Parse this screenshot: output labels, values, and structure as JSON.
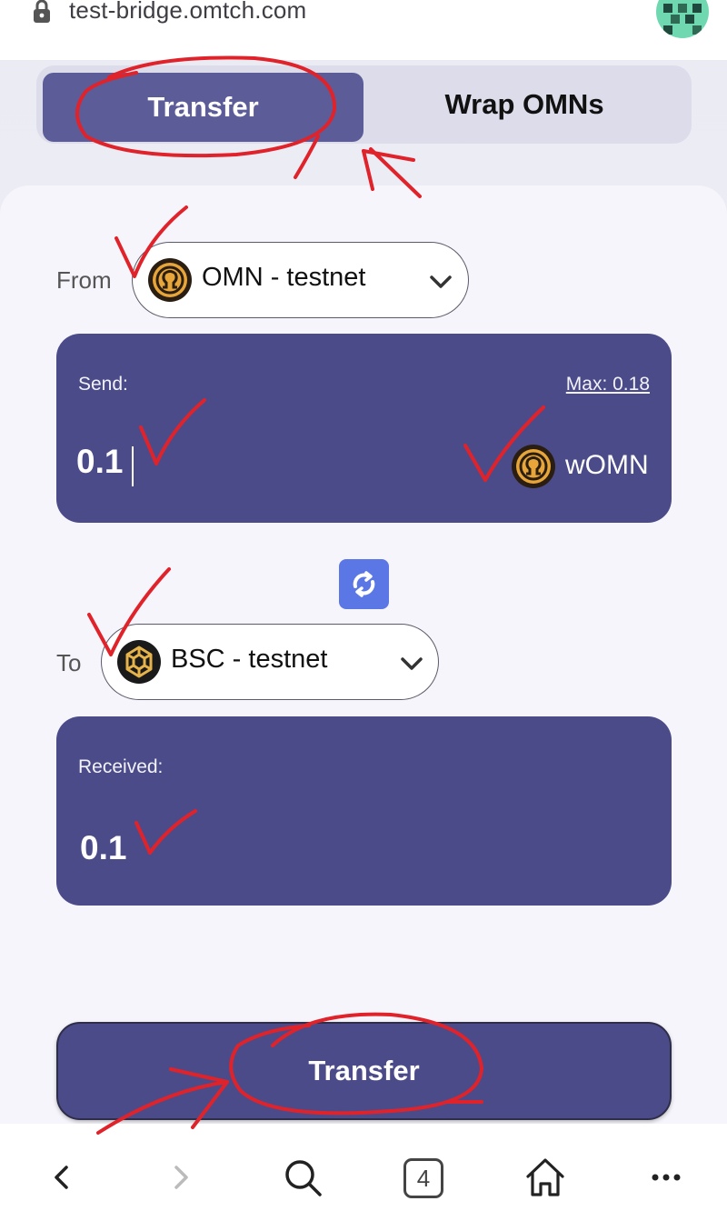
{
  "browser": {
    "url": "test-bridge.omtch.com",
    "tab_count": "4"
  },
  "tabs": {
    "transfer_label": "Transfer",
    "wrap_label": "Wrap OMNs"
  },
  "from": {
    "label": "From",
    "chain": "OMN - testnet"
  },
  "send": {
    "label": "Send:",
    "max_label": "Max: 0.18",
    "amount": "0.1",
    "token": "wOMN"
  },
  "to": {
    "label": "To",
    "chain": "BSC - testnet"
  },
  "received": {
    "label": "Received:",
    "amount": "0.1"
  },
  "actions": {
    "transfer_button": "Transfer"
  },
  "icons": {
    "lock": "lock-icon",
    "omn": "omn-coin-icon",
    "bsc": "bnb-coin-icon",
    "swap": "swap-icon",
    "back": "back-icon",
    "forward": "forward-icon",
    "search": "search-icon",
    "home": "home-icon",
    "more": "more-icon"
  },
  "colors": {
    "primary": "#4b4b8a",
    "tab_active": "#5c5c98",
    "swap": "#5b77e6",
    "annotation": "#e0232a",
    "coin_gold": "#e8a63a"
  }
}
